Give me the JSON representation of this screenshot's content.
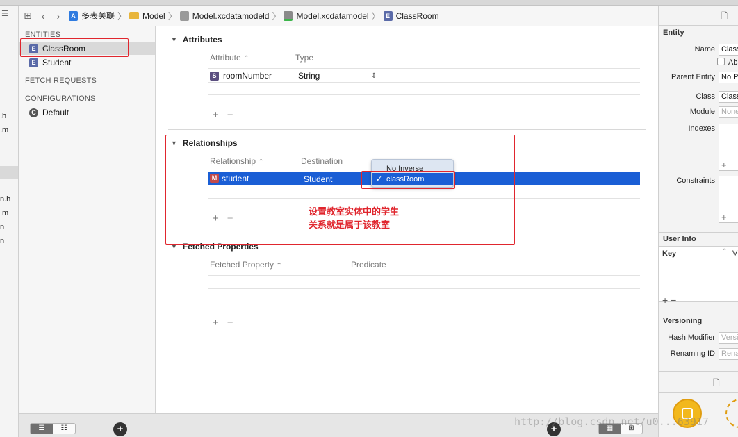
{
  "jumpbar": {
    "crumbs": [
      "多表关联",
      "Model",
      "Model.xcdatamodeld",
      "Model.xcdatamodel",
      "ClassRoom"
    ]
  },
  "leftstrip": {
    "items": [
      ".h",
      ".m",
      "n.h",
      ".m",
      "n",
      "n"
    ]
  },
  "outline": {
    "entities_header": "ENTITIES",
    "entities": [
      "ClassRoom",
      "Student"
    ],
    "fetch_requests_header": "FETCH REQUESTS",
    "configurations_header": "CONFIGURATIONS",
    "configurations": [
      "Default"
    ]
  },
  "attributes": {
    "title": "Attributes",
    "col_attribute": "Attribute",
    "col_type": "Type",
    "rows": [
      {
        "name": "roomNumber",
        "type": "String"
      }
    ]
  },
  "relationships": {
    "title": "Relationships",
    "col_relationship": "Relationship",
    "col_destination": "Destination",
    "rows": [
      {
        "name": "student",
        "destination": "Student"
      }
    ],
    "inverse_options": [
      "No Inverse",
      "classRoom"
    ],
    "inverse_selected": "classRoom"
  },
  "fetched": {
    "title": "Fetched Properties",
    "col_property": "Fetched Property",
    "col_predicate": "Predicate"
  },
  "annotation": {
    "line1": "设置教室实体中的学生",
    "line2": "关系就是属于该教室"
  },
  "inspector": {
    "entity_title": "Entity",
    "name_label": "Name",
    "name_value": "ClassRoom",
    "abstract_label": "Abstract",
    "parent_label": "Parent Entity",
    "parent_value": "No Parent",
    "class_label": "Class",
    "class_value": "ClassRoom",
    "module_label": "Module",
    "module_placeholder": "None",
    "indexes_label": "Indexes",
    "constraints_label": "Constraints",
    "userinfo_title": "User Info",
    "key_label": "Key",
    "value_label": "V",
    "versioning_title": "Versioning",
    "hash_label": "Hash Modifier",
    "hash_placeholder": "Version",
    "renaming_label": "Renaming ID",
    "renaming_placeholder": "Renaming"
  },
  "watermark": "http://blog.csdn.net/u0...63917",
  "colors": {
    "selection": "#1a5ed5",
    "annotation": "#e0262e"
  }
}
